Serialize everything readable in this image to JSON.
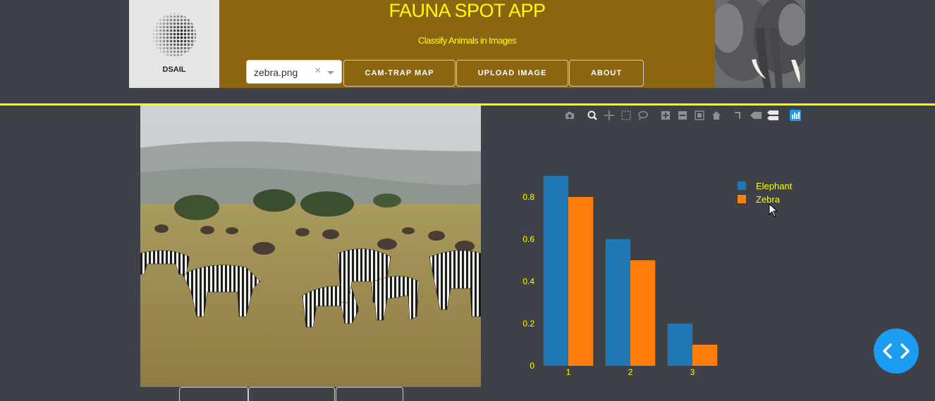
{
  "header": {
    "logo_text": "DSAIL",
    "title": "FAUNA SPOT APP",
    "subtitle": "Classify Animals in Images",
    "image_select": {
      "value": "zebra.png",
      "clear": "×"
    },
    "nav": {
      "cam_trap": "CAM-TRAP MAP",
      "upload": "UPLOAD IMAGE",
      "about": "ABOUT"
    }
  },
  "colors": {
    "accent": "#ffff00",
    "header_bg": "#8b6510",
    "page_bg": "#3e4147",
    "fab": "#1a9cf0"
  },
  "modebar": [
    "camera-icon",
    "zoom-icon",
    "pan-icon",
    "box-select-icon",
    "lasso-select-icon",
    "zoom-in-icon",
    "zoom-out-icon",
    "autoscale-icon",
    "home-icon",
    "spike-lines-icon",
    "hover-closest-icon",
    "hover-compare-icon",
    "plotly-logo-icon"
  ],
  "chart_data": {
    "type": "bar",
    "categories": [
      "1",
      "2",
      "3"
    ],
    "series": [
      {
        "name": "Elephant",
        "values": [
          0.9,
          0.6,
          0.2
        ],
        "color": "#1f77b4"
      },
      {
        "name": "Zebra",
        "values": [
          0.8,
          0.5,
          0.1
        ],
        "color": "#ff7f0e"
      }
    ],
    "yticks": [
      "0",
      "0.2",
      "0.4",
      "0.6",
      "0.8"
    ],
    "ylim": [
      0,
      0.95
    ],
    "legend": "top-right",
    "grid": false
  }
}
